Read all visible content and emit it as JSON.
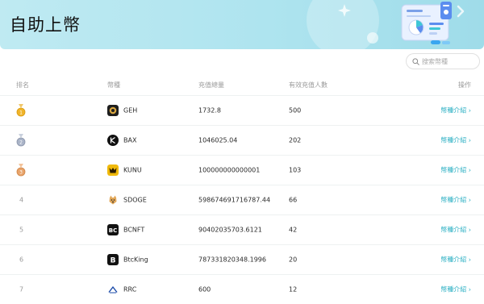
{
  "banner": {
    "title": "自助上幣"
  },
  "search": {
    "placeholder": "搜索幣種"
  },
  "table": {
    "headers": {
      "rank": "排名",
      "coin": "幣種",
      "amount": "充值總量",
      "holders": "有效充值人數",
      "action": "操作"
    },
    "rows": [
      {
        "rank": "1",
        "medal": "gold",
        "icon": "geh-logo-icon",
        "coin": "GEH",
        "amount": "1732.8",
        "holders": "500",
        "action": "幣種介紹 ›"
      },
      {
        "rank": "2",
        "medal": "silver",
        "icon": "bax-logo-icon",
        "coin": "BAX",
        "amount": "1046025.04",
        "holders": "202",
        "action": "幣種介紹 ›"
      },
      {
        "rank": "3",
        "medal": "bronze",
        "icon": "kunu-logo-icon",
        "coin": "KUNU",
        "amount": "100000000000001",
        "holders": "103",
        "action": "幣種介紹 ›"
      },
      {
        "rank": "4",
        "medal": "",
        "icon": "sdoge-logo-icon",
        "coin": "SDOGE",
        "amount": "598674691716787.44",
        "holders": "66",
        "action": "幣種介紹 ›"
      },
      {
        "rank": "5",
        "medal": "",
        "icon": "bcnft-logo-icon",
        "coin": "BCNFT",
        "amount": "90402035703.6121",
        "holders": "42",
        "action": "幣種介紹 ›"
      },
      {
        "rank": "6",
        "medal": "",
        "icon": "btcking-logo-icon",
        "coin": "BtcKing",
        "amount": "787331820348.1996",
        "holders": "20",
        "action": "幣種介紹 ›"
      },
      {
        "rank": "7",
        "medal": "",
        "icon": "rrc-logo-icon",
        "coin": "RRC",
        "amount": "600",
        "holders": "12",
        "action": "幣種介紹 ›"
      }
    ]
  },
  "colors": {
    "accent": "#2fb1c4",
    "banner": "#aee4ef",
    "gold": "#f0b429",
    "silver": "#a9b3c7",
    "bronze": "#e8a36a"
  }
}
